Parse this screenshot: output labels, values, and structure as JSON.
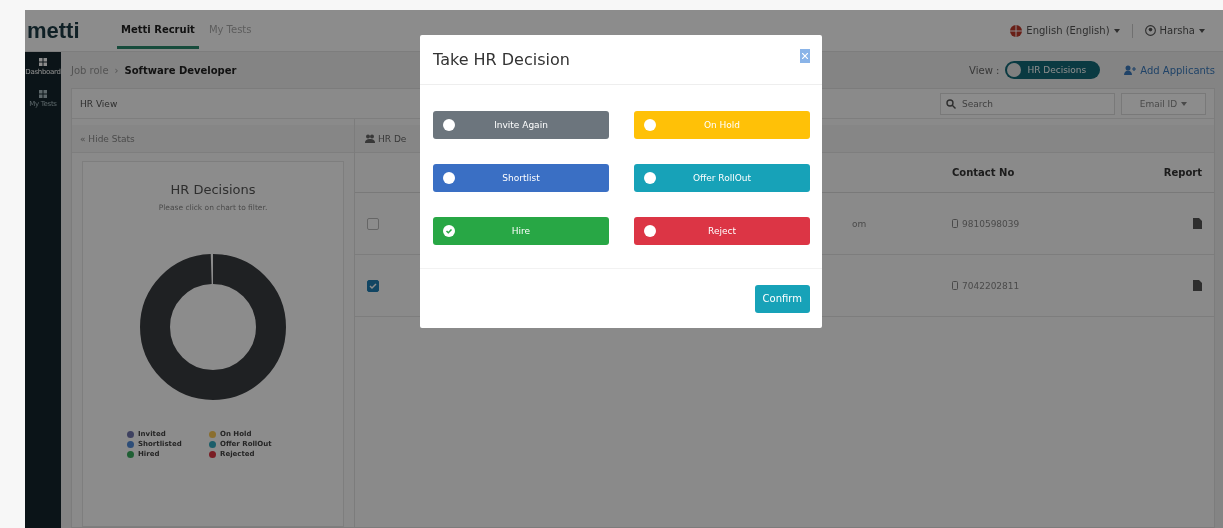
{
  "header": {
    "logo": "metti",
    "nav": [
      {
        "label": "Metti Recruit",
        "selected": true
      },
      {
        "label": "My Tests",
        "selected": false
      }
    ],
    "language": "English (English)",
    "user": "Harsha"
  },
  "sidebar": {
    "items": [
      {
        "label": "Dashboard",
        "selected": true
      },
      {
        "label": "My Tests",
        "selected": false
      }
    ]
  },
  "breadcrumb": {
    "parent": "Job role",
    "separator": "›",
    "current": "Software Developer"
  },
  "view": {
    "label": "View :",
    "toggle": "HR Decisions",
    "on": true
  },
  "add_applicants": "Add Applicants",
  "panel": {
    "title": "HR View",
    "search": {
      "placeholder": "Search"
    },
    "filter": "Email ID"
  },
  "hide_stats": "« Hide Stats",
  "stats": {
    "title": "HR Decisions",
    "hint": "Please click on chart to filter.",
    "legend": [
      {
        "label": "Invited",
        "color": "#3e4160"
      },
      {
        "label": "On Hold",
        "color": "#8a6e2e"
      },
      {
        "label": "Shortlisted",
        "color": "#2d4d78"
      },
      {
        "label": "Offer RollOut",
        "color": "#1b5e6a"
      },
      {
        "label": "Hired",
        "color": "#1f5f34"
      },
      {
        "label": "Rejected",
        "color": "#7a1d24"
      }
    ]
  },
  "tab": "HR De",
  "table": {
    "columns": [
      "Contact No",
      "Report"
    ],
    "rows": [
      {
        "checked": false,
        "column_3": "om",
        "contact": "9810598039"
      },
      {
        "checked": true,
        "contact": "7042202811"
      }
    ]
  },
  "modal": {
    "title": "Take HR Decision",
    "options": [
      {
        "label": "Invite Again",
        "color": "#6c757d",
        "selected": false
      },
      {
        "label": "On Hold",
        "color": "#ffc107",
        "selected": false
      },
      {
        "label": "Shortlist",
        "color": "#3a6fc4",
        "selected": false
      },
      {
        "label": "Offer RollOut",
        "color": "#17a2b8",
        "selected": false
      },
      {
        "label": "Hire",
        "color": "#28a745",
        "selected": true
      },
      {
        "label": "Reject",
        "color": "#dc3545",
        "selected": false
      }
    ],
    "confirm": "Confirm"
  }
}
